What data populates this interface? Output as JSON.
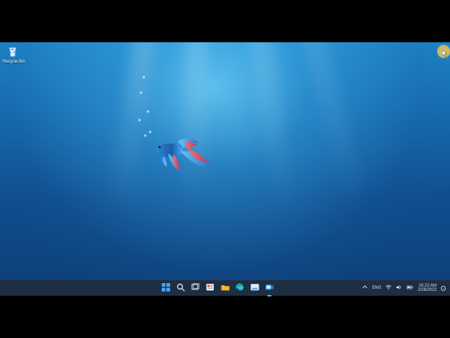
{
  "desktop": {
    "recycle_bin_label": "Recycle Bin",
    "icon_names": {
      "recycle_bin": "recycle-bin-icon",
      "fish": "betta-fish-wallpaper",
      "cursor": "pointer-arrow-icon"
    },
    "colors": {
      "wallpaper_top": "#1e86c8",
      "wallpaper_bottom": "#0d3e77",
      "taskbar": "#1f2e3f",
      "cursor_highlight": "#e8c652",
      "accent": "#5cb8ff"
    }
  },
  "taskbar": {
    "apps": [
      {
        "name": "start-button",
        "icon": "windows-start-icon"
      },
      {
        "name": "search-button",
        "icon": "search-icon"
      },
      {
        "name": "task-view-button",
        "icon": "task-view-icon"
      },
      {
        "name": "widgets-button",
        "icon": "widgets-icon"
      },
      {
        "name": "file-explorer-button",
        "icon": "folder-icon"
      },
      {
        "name": "edge-button",
        "icon": "edge-icon"
      },
      {
        "name": "photos-button",
        "icon": "photos-icon"
      },
      {
        "name": "meet-button",
        "icon": "camera-icon"
      }
    ],
    "tray": {
      "language": "ENG",
      "time": "10:22 AM",
      "date": "2/26/2022"
    }
  }
}
